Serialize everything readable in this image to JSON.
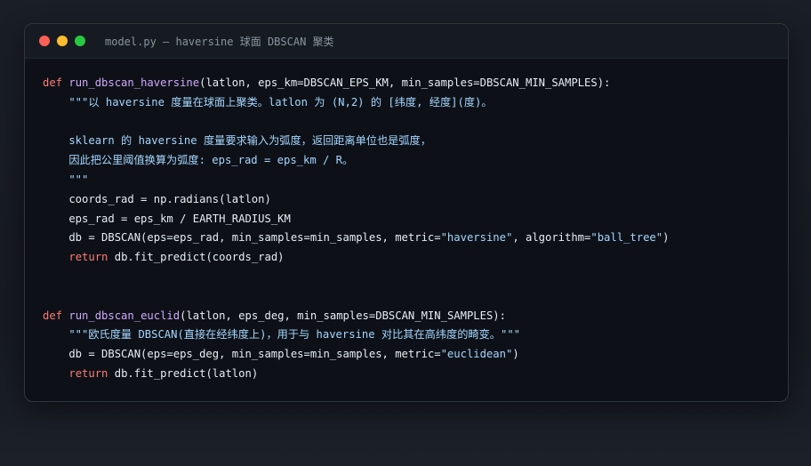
{
  "window": {
    "title": "model.py — haversine 球面 DBSCAN 聚类",
    "controls": {
      "close": "close-dot",
      "minimize": "minimize-dot",
      "maximize": "maximize-dot"
    }
  },
  "colors": {
    "keyword": "#ff7b72",
    "function": "#d2a8ff",
    "string": "#a5d6ff",
    "text": "#e6edf3",
    "close": "#ff5f57",
    "minimize": "#febc2e",
    "maximize": "#28c840",
    "editor_bg": "#0d1117",
    "titlebar_bg": "#161b22"
  },
  "code": {
    "lines": [
      [
        {
          "t": "def",
          "k": "kw"
        },
        {
          "t": " ",
          "k": "plain"
        },
        {
          "t": "run_dbscan_haversine",
          "k": "fn"
        },
        {
          "t": "(latlon, eps_km=DBSCAN_EPS_KM, min_samples=DBSCAN_MIN_SAMPLES):",
          "k": "plain"
        }
      ],
      [
        {
          "t": "    \"\"\"以 haversine 度量在球面上聚类。latlon 为 (N,2) 的 [纬度, 经度](度)。",
          "k": "str"
        }
      ],
      [],
      [
        {
          "t": "    sklearn 的 haversine 度量要求输入为弧度，返回距离单位也是弧度，",
          "k": "str"
        }
      ],
      [
        {
          "t": "    因此把公里阈值换算为弧度: eps_rad = eps_km / R。",
          "k": "str"
        }
      ],
      [
        {
          "t": "    \"\"\"",
          "k": "str"
        }
      ],
      [
        {
          "t": "    coords_rad = np.radians(latlon)",
          "k": "plain"
        }
      ],
      [
        {
          "t": "    eps_rad = eps_km / EARTH_RADIUS_KM",
          "k": "plain"
        }
      ],
      [
        {
          "t": "    db = DBSCAN(eps=eps_rad, min_samples=min_samples, metric=",
          "k": "plain"
        },
        {
          "t": "\"haversine\"",
          "k": "str"
        },
        {
          "t": ", algorithm=",
          "k": "plain"
        },
        {
          "t": "\"ball_tree\"",
          "k": "str"
        },
        {
          "t": ")",
          "k": "plain"
        }
      ],
      [
        {
          "t": "    ",
          "k": "plain"
        },
        {
          "t": "return",
          "k": "kw"
        },
        {
          "t": " db.fit_predict(coords_rad)",
          "k": "plain"
        }
      ],
      [],
      [],
      [
        {
          "t": "def",
          "k": "kw"
        },
        {
          "t": " ",
          "k": "plain"
        },
        {
          "t": "run_dbscan_euclid",
          "k": "fn"
        },
        {
          "t": "(latlon, eps_deg, min_samples=DBSCAN_MIN_SAMPLES):",
          "k": "plain"
        }
      ],
      [
        {
          "t": "    \"\"\"欧氏度量 DBSCAN(直接在经纬度上)，用于与 haversine 对比其在高纬度的畸变。\"\"\"",
          "k": "str"
        }
      ],
      [
        {
          "t": "    db = DBSCAN(eps=eps_deg, min_samples=min_samples, metric=",
          "k": "plain"
        },
        {
          "t": "\"euclidean\"",
          "k": "str"
        },
        {
          "t": ")",
          "k": "plain"
        }
      ],
      [
        {
          "t": "    ",
          "k": "plain"
        },
        {
          "t": "return",
          "k": "kw"
        },
        {
          "t": " db.fit_predict(latlon)",
          "k": "plain"
        }
      ]
    ]
  }
}
